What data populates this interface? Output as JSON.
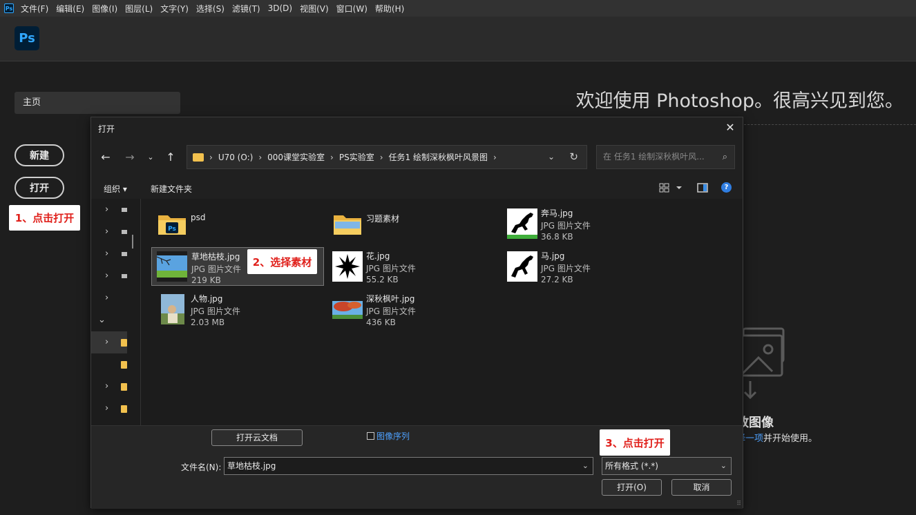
{
  "menubar": {
    "app_icon": "Ps",
    "items": [
      "文件(F)",
      "编辑(E)",
      "图像(I)",
      "图层(L)",
      "文字(Y)",
      "选择(S)",
      "滤镜(T)",
      "3D(D)",
      "视图(V)",
      "窗口(W)",
      "帮助(H)"
    ]
  },
  "app": {
    "logo": "Ps",
    "home": "主页",
    "new_button": "新建",
    "open_button": "打开",
    "welcome": "欢迎使用 Photoshop。很高兴见到您。",
    "drop_title": "放图像",
    "drop_text_link": "择一项",
    "drop_text_rest": "并开始使用。"
  },
  "callouts": {
    "step1": "1、点击打开",
    "step2": "2、选择素材",
    "step3": "3、点击打开"
  },
  "dialog": {
    "title": "打开",
    "close": "✕",
    "breadcrumbs": [
      "U70 (O:)",
      "000课堂实验室",
      "PS实验室",
      "任务1  绘制深秋枫叶风景图"
    ],
    "search_placeholder": "在 任务1  绘制深秋枫叶风...",
    "toolbar": {
      "organize": "组织 ▾",
      "new_folder": "新建文件夹"
    },
    "files": [
      {
        "name": "psd",
        "type": "",
        "size": "",
        "icon": "folder-ps"
      },
      {
        "name": "习题素材",
        "type": "",
        "size": "",
        "icon": "folder"
      },
      {
        "name": "奔马.jpg",
        "type": "JPG 图片文件",
        "size": "36.8 KB",
        "icon": "horse-image"
      },
      {
        "name": "草地枯枝.jpg",
        "type": "JPG 图片文件",
        "size": "219 KB",
        "icon": "landscape-image"
      },
      {
        "name": "花.jpg",
        "type": "JPG 图片文件",
        "size": "55.2 KB",
        "icon": "flower-image"
      },
      {
        "name": "马.jpg",
        "type": "JPG 图片文件",
        "size": "27.2 KB",
        "icon": "horse-image"
      },
      {
        "name": "人物.jpg",
        "type": "JPG 图片文件",
        "size": "2.03 MB",
        "icon": "person-image"
      },
      {
        "name": "深秋枫叶.jpg",
        "type": "JPG 图片文件",
        "size": "436 KB",
        "icon": "autumn-image"
      }
    ],
    "cloud_button": "打开云文档",
    "image_sequence": "图像序列",
    "filename_label": "文件名(N):",
    "filename_value": "草地枯枝.jpg",
    "filetype_value": "所有格式 (*.*)",
    "open_button": "打开(O)",
    "cancel_button": "取消"
  }
}
